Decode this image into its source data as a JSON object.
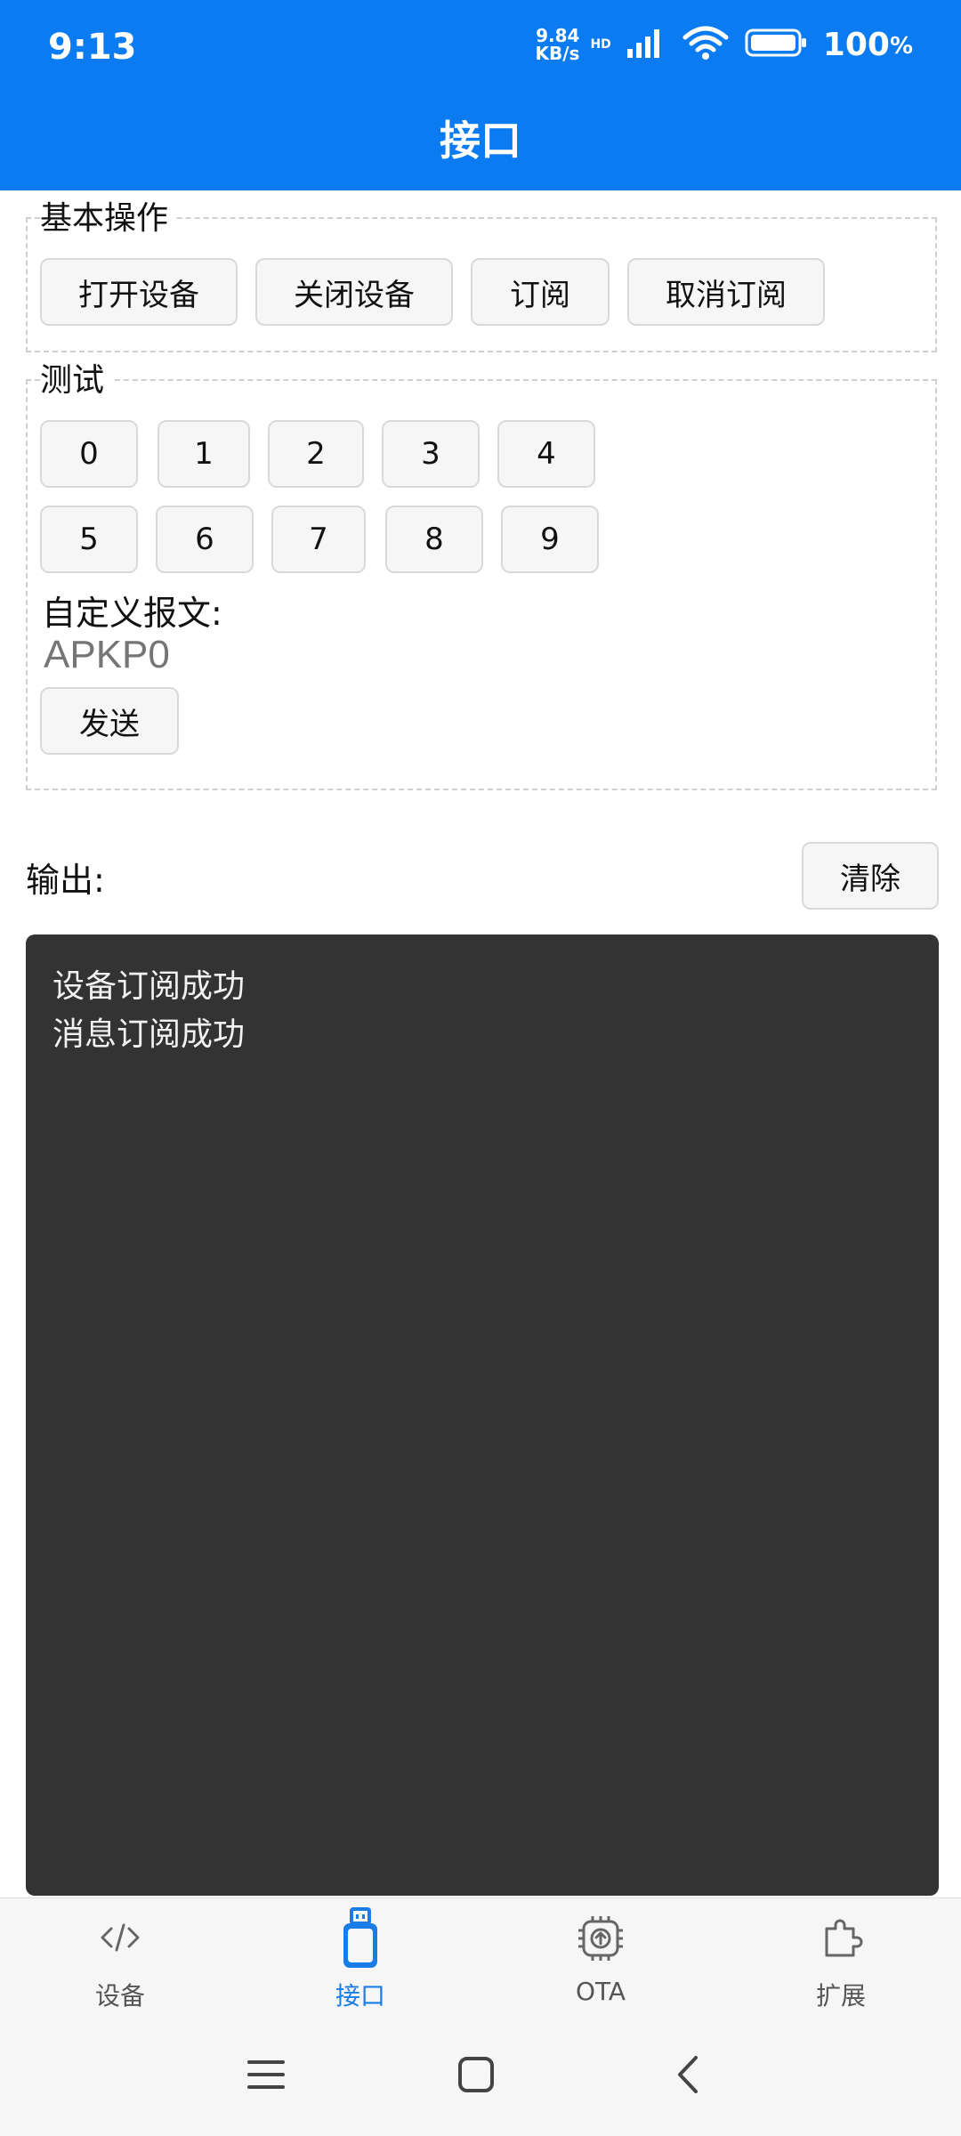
{
  "status_bar": {
    "time": "9:13",
    "net_speed_value": "9.84",
    "net_speed_unit": "KB/s",
    "hd": "HD",
    "battery": "100",
    "battery_suffix": "%"
  },
  "app_bar": {
    "title": "接口"
  },
  "basic_ops": {
    "legend": "基本操作",
    "buttons": [
      "打开设备",
      "关闭设备",
      "订阅",
      "取消订阅"
    ]
  },
  "test": {
    "legend": "测试",
    "digits_row1": [
      "0",
      "1",
      "2",
      "3",
      "4"
    ],
    "digits_row2": [
      "5",
      "6",
      "7",
      "8",
      "9"
    ],
    "custom_label": "自定义报文:",
    "custom_placeholder": "APKP0",
    "send_label": "发送"
  },
  "output": {
    "label": "输出:",
    "clear_label": "清除",
    "lines": [
      "设备订阅成功",
      "消息订阅成功"
    ]
  },
  "bottom_nav": {
    "items": [
      {
        "label": "设备",
        "icon": "code-icon"
      },
      {
        "label": "接口",
        "icon": "usb-icon"
      },
      {
        "label": "OTA",
        "icon": "chip-upload-icon"
      },
      {
        "label": "扩展",
        "icon": "puzzle-icon"
      }
    ],
    "active_index": 1,
    "active_color": "#1a7de7"
  },
  "colors": {
    "app_bar": "#0a7bf1",
    "console_bg": "#333333"
  }
}
